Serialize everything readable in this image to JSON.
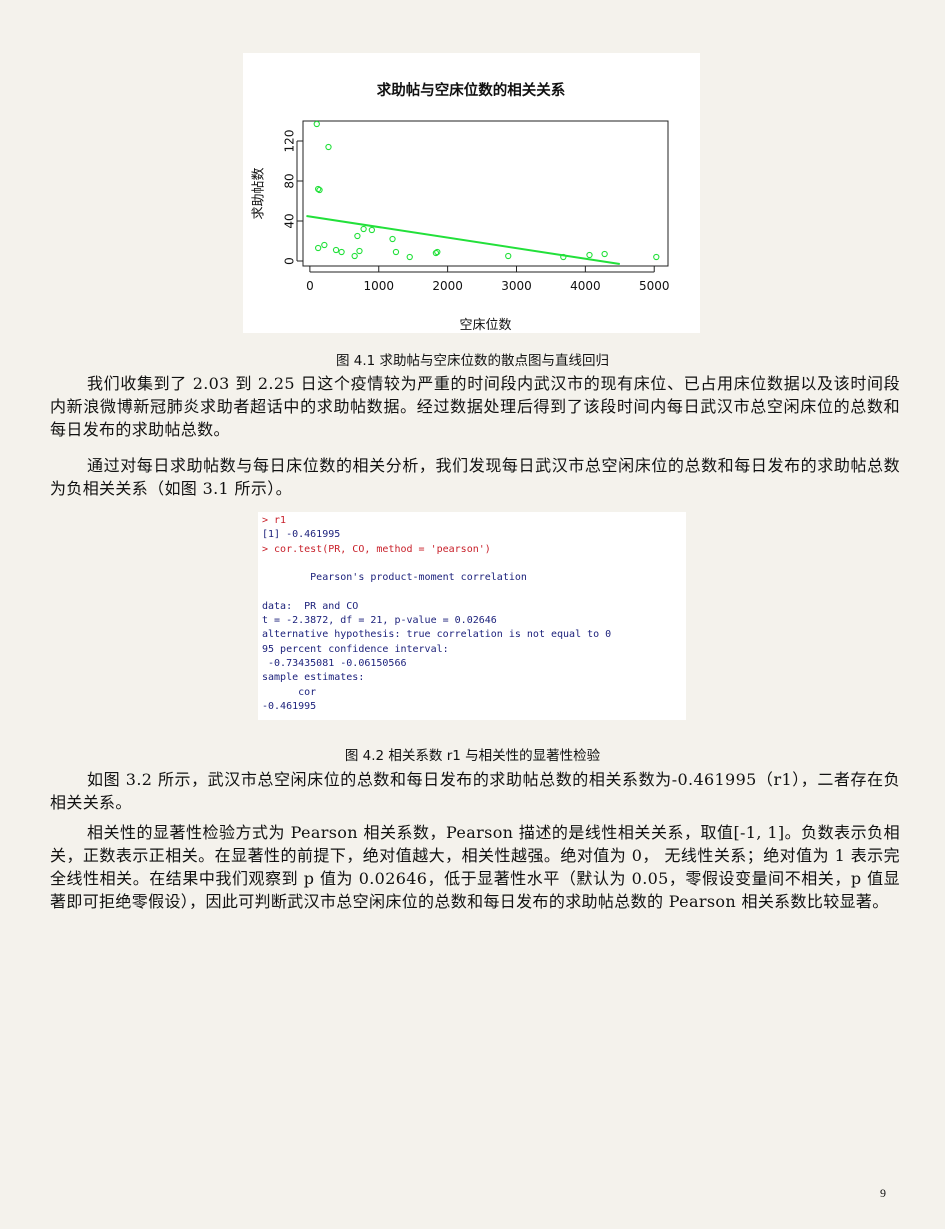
{
  "figure1": {
    "caption": "图 4.1 求助帖与空床位数的散点图与直线回归",
    "chart_data": {
      "type": "scatter",
      "title": "求助帖与空床位数的相关关系",
      "xlabel": "空床位数",
      "ylabel": "求助帖数",
      "xlim": [
        -100,
        5200
      ],
      "ylim": [
        -5,
        140
      ],
      "xticks": [
        "0",
        "1000",
        "2000",
        "3000",
        "4000",
        "5000"
      ],
      "yticks": [
        "0",
        "40",
        "80",
        "120"
      ],
      "point_color": "#22e03a",
      "line_color": "#22e03a",
      "points": [
        {
          "x": 100,
          "y": 137
        },
        {
          "x": 270,
          "y": 114
        },
        {
          "x": 120,
          "y": 72
        },
        {
          "x": 140,
          "y": 71
        },
        {
          "x": 120,
          "y": 13
        },
        {
          "x": 210,
          "y": 16
        },
        {
          "x": 380,
          "y": 11
        },
        {
          "x": 460,
          "y": 9
        },
        {
          "x": 650,
          "y": 5
        },
        {
          "x": 690,
          "y": 25
        },
        {
          "x": 720,
          "y": 10
        },
        {
          "x": 780,
          "y": 32
        },
        {
          "x": 900,
          "y": 31
        },
        {
          "x": 1200,
          "y": 22
        },
        {
          "x": 1250,
          "y": 9
        },
        {
          "x": 1450,
          "y": 4
        },
        {
          "x": 1830,
          "y": 8
        },
        {
          "x": 1850,
          "y": 9
        },
        {
          "x": 2880,
          "y": 5
        },
        {
          "x": 3680,
          "y": 4
        },
        {
          "x": 4060,
          "y": 6
        },
        {
          "x": 4280,
          "y": 7
        },
        {
          "x": 5030,
          "y": 4
        }
      ],
      "regression_line": {
        "x": [
          -50,
          4500
        ],
        "y": [
          45,
          -3
        ]
      }
    }
  },
  "paragraphs": {
    "p1": "我们收集到了 2.03 到 2.25 日这个疫情较为严重的时间段内武汉市的现有床位、已占用床位数据以及该时间段内新浪微博新冠肺炎求助者超话中的求助帖数据。经过数据处理后得到了该段时间内每日武汉市总空闲床位的总数和每日发布的求助帖总数。",
    "p2": "通过对每日求助帖数与每日床位数的相关分析，我们发现每日武汉市总空闲床位的总数和每日发布的求助帖总数为负相关关系（如图 3.1 所示）。",
    "p3": "如图 3.2 所示，武汉市总空闲床位的总数和每日发布的求助帖总数的相关系数为-0.461995（r1），二者存在负相关关系。",
    "p4": "相关性的显著性检验方式为 Pearson 相关系数，Pearson 描述的是线性相关关系，取值[-1, 1]。负数表示负相关，正数表示正相关。在显著性的前提下，绝对值越大，相关性越强。绝对值为 0， 无线性关系；绝对值为 1 表示完全线性相关。在结果中我们观察到 p 值为 0.02646，低于显著性水平（默认为 0.05，零假设变量间不相关，p 值显著即可拒绝零假设），因此可判断武汉市总空闲床位的总数和每日发布的求助帖总数的 Pearson 相关系数比较显著。"
  },
  "figure2": {
    "caption": "图 4.2 相关系数 r1 与相关性的显著性检验",
    "lines": [
      {
        "kind": "cmd",
        "text": "> r1"
      },
      {
        "kind": "out",
        "text": "[1] -0.461995"
      },
      {
        "kind": "cmd",
        "text": "> cor.test(PR, CO, method = 'pearson')"
      },
      {
        "kind": "out",
        "text": ""
      },
      {
        "kind": "out",
        "text": "        Pearson's product-moment correlation"
      },
      {
        "kind": "out",
        "text": ""
      },
      {
        "kind": "out",
        "text": "data:  PR and CO"
      },
      {
        "kind": "out",
        "text": "t = -2.3872, df = 21, p-value = 0.02646"
      },
      {
        "kind": "out",
        "text": "alternative hypothesis: true correlation is not equal to 0"
      },
      {
        "kind": "out",
        "text": "95 percent confidence interval:"
      },
      {
        "kind": "out",
        "text": " -0.73435081 -0.06150566"
      },
      {
        "kind": "out",
        "text": "sample estimates:"
      },
      {
        "kind": "out",
        "text": "      cor"
      },
      {
        "kind": "out",
        "text": "-0.461995"
      }
    ]
  },
  "page_number": "9"
}
